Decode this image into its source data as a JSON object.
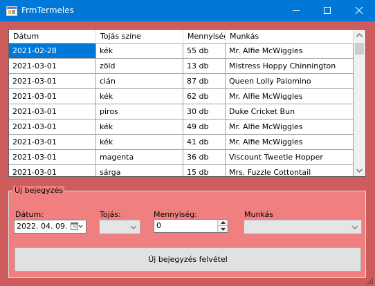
{
  "window": {
    "title": "FrmTermeles",
    "icons": {
      "app": "app-form-icon",
      "minimize": "minimize-icon",
      "maximize": "maximize-icon",
      "close": "close-icon"
    }
  },
  "grid": {
    "columns": [
      "Dátum",
      "Tojás színe",
      "Mennyiség",
      "Munkás"
    ],
    "rows": [
      [
        "2021-02-28",
        "kék",
        "55 db",
        "Mr. Alfie McWiggles"
      ],
      [
        "2021-03-01",
        "zöld",
        "13 db",
        "Mistress Hoppy Chinnington"
      ],
      [
        "2021-03-01",
        "cián",
        "87 db",
        "Queen Lolly Palomino"
      ],
      [
        "2021-03-01",
        "kék",
        "62 db",
        "Mr. Alfie McWiggles"
      ],
      [
        "2021-03-01",
        "piros",
        "30 db",
        "Duke Cricket Bun"
      ],
      [
        "2021-03-01",
        "kék",
        "49 db",
        "Mr. Alfie McWiggles"
      ],
      [
        "2021-03-01",
        "kék",
        "41 db",
        "Mr. Alfie McWiggles"
      ],
      [
        "2021-03-01",
        "magenta",
        "36 db",
        "Viscount Tweetie Hopper"
      ],
      [
        "2021-03-01",
        "sárga",
        "15 db",
        "Mrs. Fuzzle Cottontail"
      ]
    ],
    "selected_cell": "2021-02-28"
  },
  "form": {
    "group_title": "Új bejegyzés",
    "date_label": "Dátum:",
    "date_value": "2022. 04. 09.",
    "egg_label": "Tojás:",
    "egg_value": "",
    "qty_label": "Mennyiség:",
    "qty_value": "0",
    "worker_label": "Munkás",
    "worker_value": "",
    "submit_label": "Új bejegyzés felvétel"
  },
  "colors": {
    "form_background": "#cd5c5c",
    "group_background": "#f08080",
    "titlebar": "#0078d7",
    "selection": "#0078d7"
  }
}
